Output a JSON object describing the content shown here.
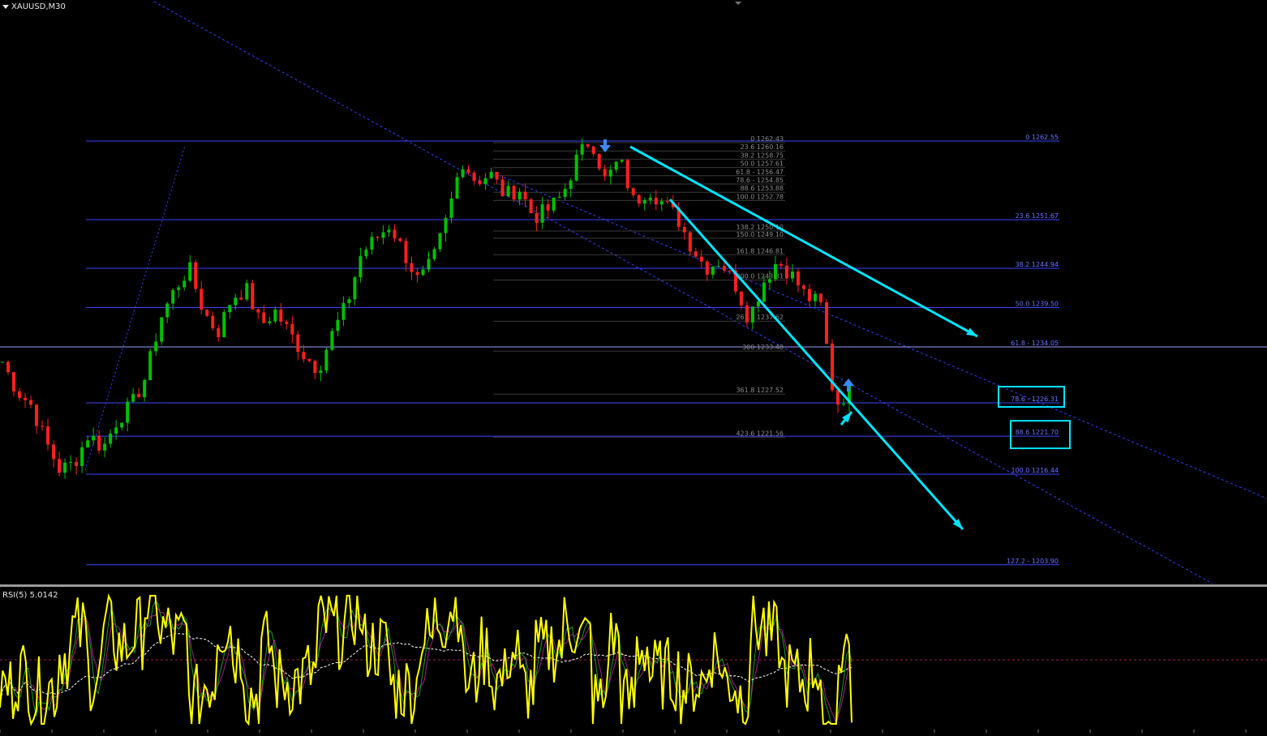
{
  "symbol_label": "XAUUSD,M30",
  "rsi_label": "RSI(5) 5.0142",
  "colors": {
    "bull": "#00c000",
    "bear": "#ff2020",
    "fib": "#3a46ff",
    "trend": "#00e5ff",
    "rsi": "#ffff00",
    "arrow": "#3b8cff"
  },
  "chart_data": [
    {
      "type": "candlestick",
      "title": "XAUUSD,M30",
      "ylim": [
        1198,
        1285
      ],
      "current_price_line": 1234.05,
      "fib_levels": [
        {
          "label": "0 1262.55",
          "price": 1262.55
        },
        {
          "label": "23.6 1251.67",
          "price": 1251.67
        },
        {
          "label": "38.2 1244.94",
          "price": 1244.94
        },
        {
          "label": "50.0 1239.50",
          "price": 1239.5
        },
        {
          "label": "61.8 - 1234.05",
          "price": 1234.05
        },
        {
          "label": "78.6 - 1226.31",
          "price": 1226.31,
          "boxed": true
        },
        {
          "label": "88.6 1221.70",
          "price": 1221.7,
          "boxed": true
        },
        {
          "label": "100.0 1216.44",
          "price": 1216.44
        },
        {
          "label": "127.2 - 1203.90",
          "price": 1203.9
        }
      ],
      "fib_inner_labels": [
        {
          "label": "0 1262.43",
          "price": 1262.43
        },
        {
          "label": "23.6 1260.16",
          "price": 1260.16
        },
        {
          "label": "38.2 1258.75",
          "price": 1258.75
        },
        {
          "label": "50.0 1257.61",
          "price": 1257.61
        },
        {
          "label": "61.8 - 1256.47",
          "price": 1256.47
        },
        {
          "label": "78.6 - 1254.85",
          "price": 1254.85
        },
        {
          "label": "88.6 1253.88",
          "price": 1253.88
        },
        {
          "label": "100.0 1252.78",
          "price": 1252.78
        }
      ],
      "fib_extensions": [
        {
          "label": "138.2 1250.10",
          "price": 1250.1
        },
        {
          "label": "150.0 1249.10",
          "price": 1249.1
        },
        {
          "label": "161.8 1246.81",
          "price": 1246.81
        },
        {
          "label": "200.0 1243.31",
          "price": 1243.31
        },
        {
          "label": "261.8 1237.62",
          "price": 1237.62
        },
        {
          "label": "300 1233.48",
          "price": 1233.48
        },
        {
          "label": "361.8 1227.52",
          "price": 1227.52
        },
        {
          "label": "423.6 1221.56",
          "price": 1221.56
        }
      ],
      "price_path": [
        1232,
        1228,
        1226,
        1221,
        1217,
        1218,
        1222,
        1220,
        1224,
        1226,
        1230,
        1238,
        1242,
        1245,
        1239,
        1236,
        1241,
        1242,
        1237,
        1239,
        1236,
        1233,
        1231,
        1236,
        1240,
        1247,
        1249,
        1251,
        1247,
        1243,
        1246,
        1252,
        1260,
        1257,
        1258,
        1255,
        1256,
        1252,
        1253,
        1255,
        1260,
        1263,
        1257,
        1260,
        1254,
        1256,
        1254,
        1252,
        1248,
        1245,
        1246,
        1243,
        1238,
        1243,
        1246,
        1244,
        1241,
        1240,
        1226,
        1228
      ],
      "rsi": {
        "label": "RSI(5) 5.0142",
        "last": 5.0142,
        "ylim": [
          0,
          100
        ],
        "reference_level": 50
      }
    }
  ]
}
